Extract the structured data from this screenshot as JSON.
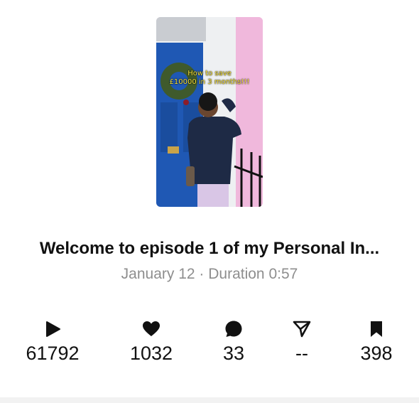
{
  "video": {
    "overlay_line1": "How to save",
    "overlay_line2": "£10000 in 3 months!!!"
  },
  "episode": {
    "title": "Welcome to episode 1 of my Personal In...",
    "meta": "January 12 · Duration 0:57"
  },
  "stats": [
    {
      "icon": "play-icon",
      "value": "61792"
    },
    {
      "icon": "heart-icon",
      "value": "1032"
    },
    {
      "icon": "comment-icon",
      "value": "33"
    },
    {
      "icon": "share-icon",
      "value": "--"
    },
    {
      "icon": "bookmark-icon",
      "value": "398"
    }
  ]
}
